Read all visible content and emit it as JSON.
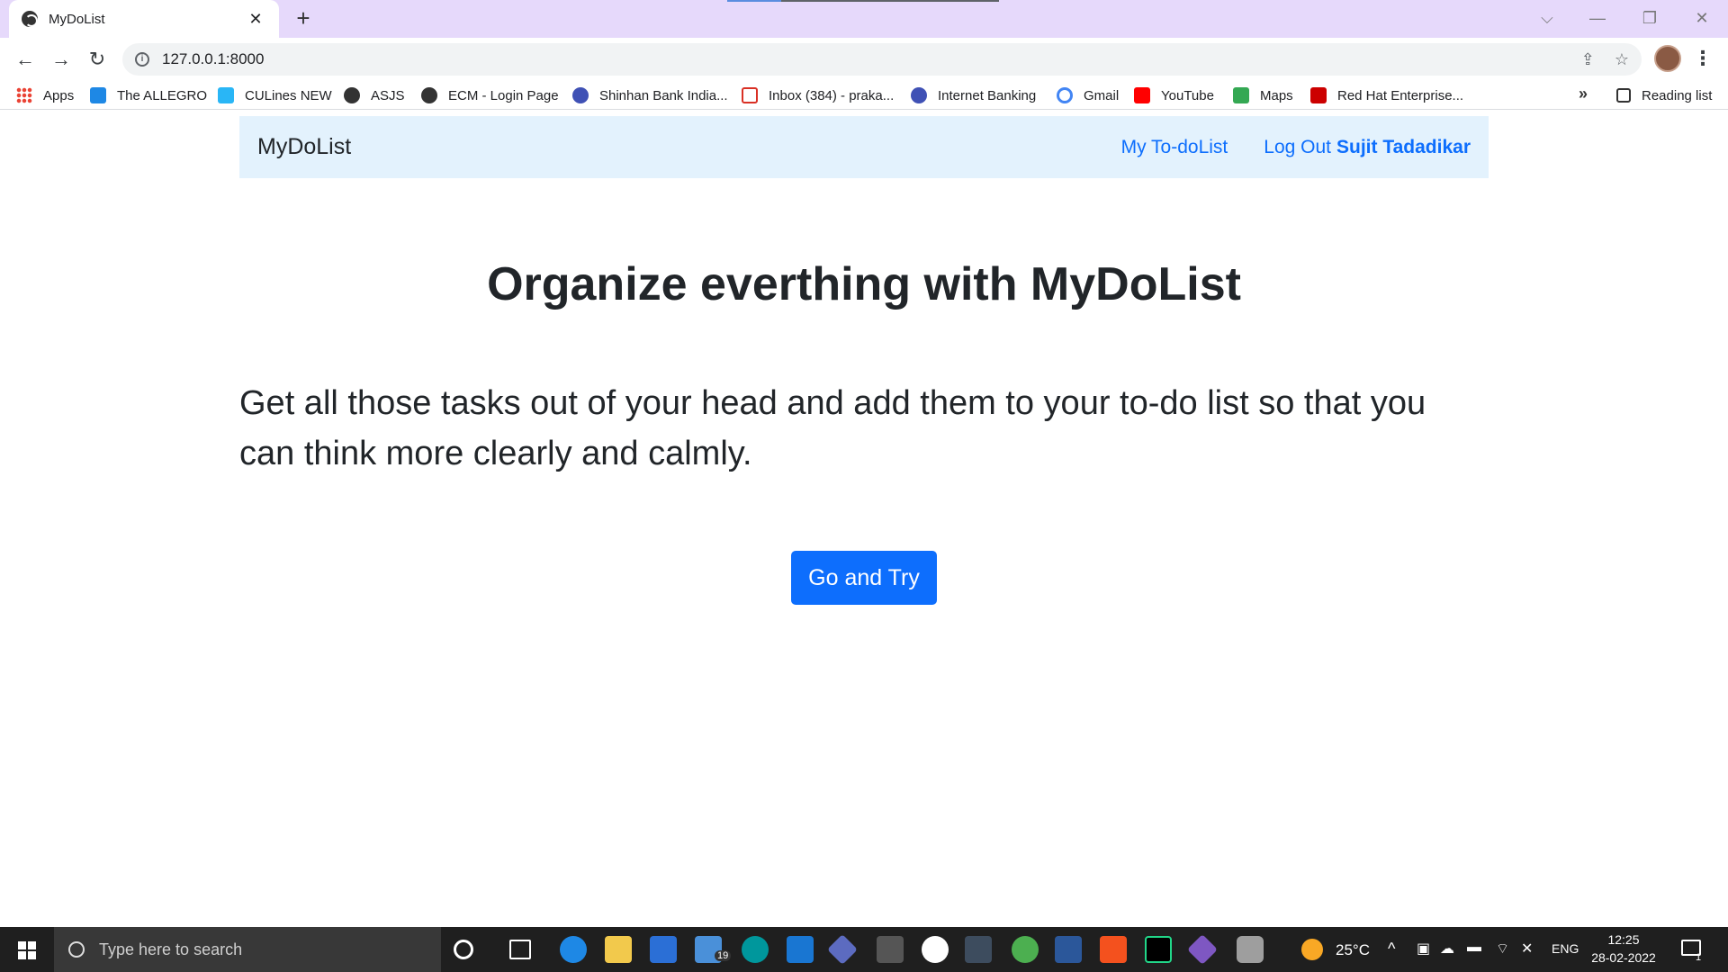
{
  "browser": {
    "tab_title": "MyDoList",
    "url": "127.0.0.1:8000",
    "bookmarks": [
      {
        "label": "Apps",
        "color": "#ea4335"
      },
      {
        "label": "The ALLEGRO",
        "color": "#1e88e5"
      },
      {
        "label": "CULines NEW",
        "color": "#29b6f6"
      },
      {
        "label": "ASJS",
        "color": "#333333"
      },
      {
        "label": "ECM - Login Page",
        "color": "#333333"
      },
      {
        "label": "Shinhan Bank India...",
        "color": "#3f51b5"
      },
      {
        "label": "Inbox (384) - praka...",
        "color": "#d93025"
      },
      {
        "label": "Internet Banking",
        "color": "#3f51b5"
      },
      {
        "label": "Gmail",
        "color": "#4285f4"
      },
      {
        "label": "YouTube",
        "color": "#ff0000"
      },
      {
        "label": "Maps",
        "color": "#34a853"
      },
      {
        "label": "Red Hat Enterprise...",
        "color": "#cc0000"
      }
    ],
    "reading_list": "Reading list"
  },
  "navbar": {
    "brand": "MyDoList",
    "todo_link": "My To-doList",
    "logout_link": "Log Out",
    "username": "Sujit Tadadikar"
  },
  "hero": {
    "title": "Organize everthing with MyDoList",
    "text": "Get all those tasks out of your head and add them to your to-do list so that you can think more clearly and calmly.",
    "button": "Go and Try"
  },
  "taskbar": {
    "search_placeholder": "Type here to search",
    "mail_badge": "19",
    "weather": "25°C",
    "language": "ENG",
    "time": "12:25",
    "date": "28-02-2022",
    "notifications": "1"
  },
  "colors": {
    "primary": "#0d6efd",
    "navbar_bg": "#e3f2fd",
    "tabstrip_bg": "#e6d9fb"
  }
}
